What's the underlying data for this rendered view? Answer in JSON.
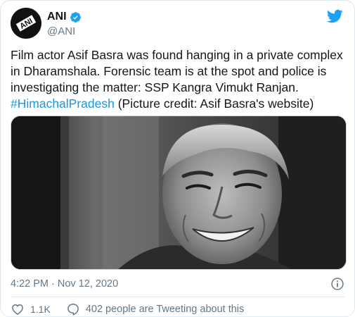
{
  "tweet": {
    "author": {
      "display_name": "ANI",
      "handle": "@ANI",
      "verified": true,
      "avatar_text": "ANI"
    },
    "text_main": "Film actor Asif Basra was found hanging in a private complex in Dharamshala. Forensic team is at the spot and police is investigating the matter: SSP Kangra Vimukt Ranjan.",
    "hashtag": "#HimachalPradesh",
    "text_tail": " (Picture credit: Asif Basra's website)",
    "timestamp": "4:22 PM · Nov 12, 2020",
    "likes": "1.1K",
    "conversation": "402 people are Tweeting about this"
  },
  "colors": {
    "link": "#1b95e0",
    "twitter_blue": "#1da1f2",
    "secondary_text": "#657786"
  },
  "icons": {
    "brand": "twitter-bird-icon",
    "verified": "verified-badge-icon",
    "info": "info-icon",
    "like": "heart-icon",
    "reply": "speech-bubble-icon"
  }
}
